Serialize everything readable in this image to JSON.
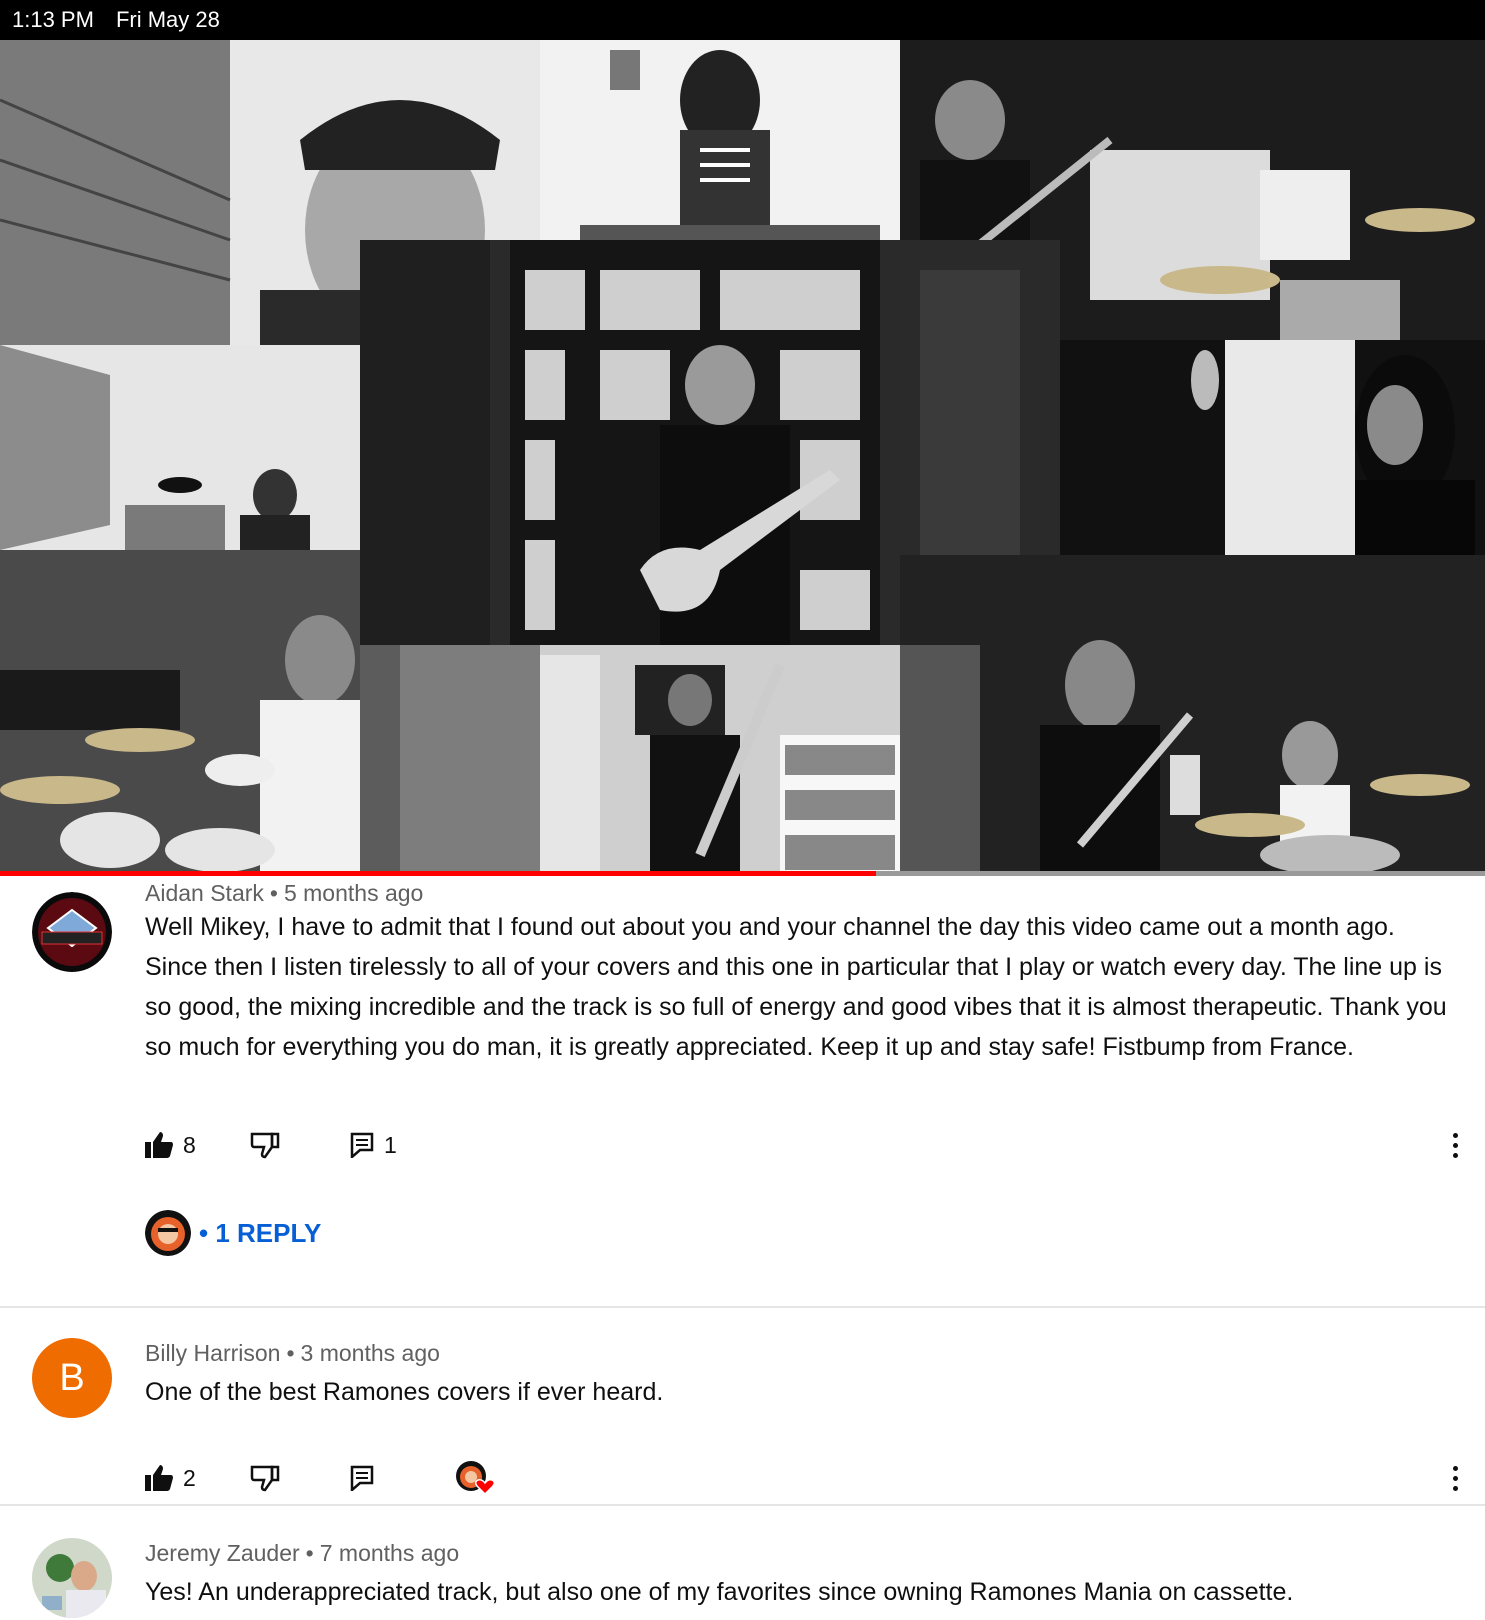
{
  "status_bar": {
    "time": "1:13 PM",
    "date": "Fri May 28"
  },
  "video": {
    "progress_fraction": 0.59
  },
  "comments": [
    {
      "author": "Aidan Stark",
      "age": "5 months ago",
      "text": "Well Mikey, I have to admit that I found out about you and your channel the day this video came out a month ago. Since then I listen tirelessly to all of your covers and this one in particular that I play or watch every day. The line up is so good, the mixing incredible and the track is so full of energy and good vibes that it is almost therapeutic. Thank you so much for everything you do man, it is greatly appreciated. Keep it up and stay safe! Fistbump from France.",
      "likes": "8",
      "replies_count": "1",
      "replies_label": "• 1 REPLY"
    },
    {
      "author": "Billy Harrison",
      "avatar_letter": "B",
      "age": "3 months ago",
      "text": "One of the best Ramones covers if ever heard.",
      "likes": "2"
    },
    {
      "author": "Jeremy Zauder",
      "age": "7 months ago",
      "text": "Yes! An underappreciated track, but also one of my favorites since owning Ramones Mania on cassette."
    }
  ],
  "icons": [
    "like-icon",
    "dislike-icon",
    "reply-icon",
    "more-icon",
    "creator-heart-icon"
  ],
  "colors": {
    "accent_red": "#ff0000",
    "link_blue": "#065fd4",
    "avatar_orange": "#ef6c00",
    "meta_gray": "#606060"
  }
}
